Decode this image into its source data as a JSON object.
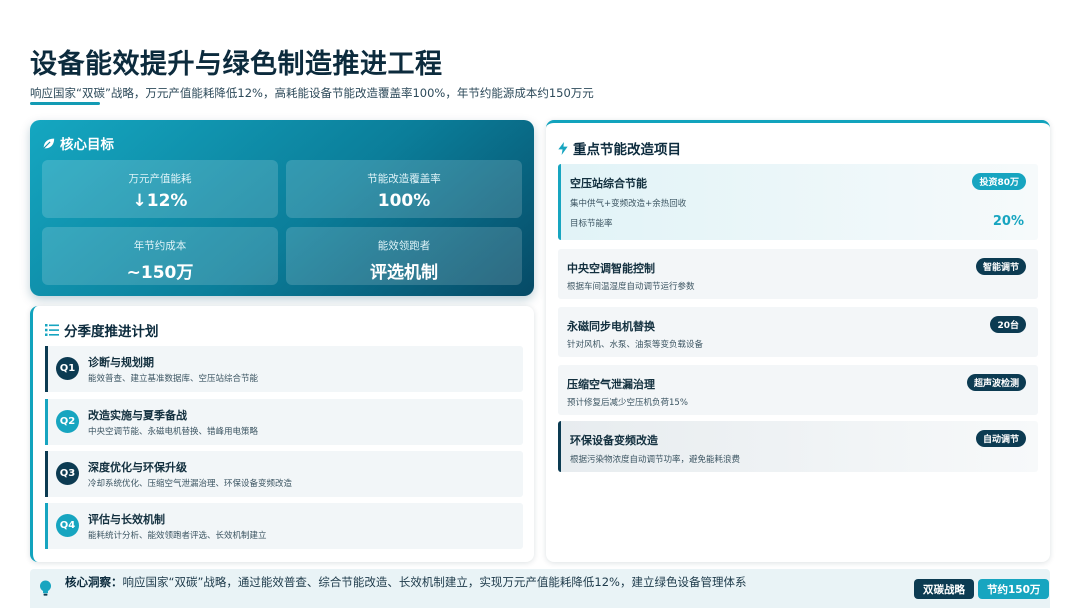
{
  "header": {
    "title": "设备能效提升与绿色制造推进工程",
    "subtitle": "响应国家“双碳”战略，万元产值能耗降低12%，高耗能设备节能改造覆盖率100%，年节约能源成本约150万元"
  },
  "core_targets": {
    "title": "核心目标",
    "icon": "leaf-icon",
    "metrics": [
      {
        "label": "万元产值能耗",
        "value": "↓12%"
      },
      {
        "label": "节能改造覆盖率",
        "value": "100%"
      },
      {
        "label": "年节约成本",
        "value": "~150万"
      },
      {
        "label": "能效领跑者",
        "value": "评选机制"
      }
    ]
  },
  "plan": {
    "title": "分季度推进计划",
    "icon": "list-icon",
    "items": [
      {
        "badge": "Q1",
        "title": "诊断与规划期",
        "desc": "能效普查、建立基准数据库、空压站综合节能"
      },
      {
        "badge": "Q2",
        "title": "改造实施与夏季备战",
        "desc": "中央空调节能、永磁电机替换、错峰用电策略"
      },
      {
        "badge": "Q3",
        "title": "深度优化与环保升级",
        "desc": "冷却系统优化、压缩空气泄漏治理、环保设备变频改造"
      },
      {
        "badge": "Q4",
        "title": "评估与长效机制",
        "desc": "能耗统计分析、能效领跑者评选、长效机制建立"
      }
    ]
  },
  "projects": {
    "title": "重点节能改造项目",
    "icon": "lightning-icon",
    "items": [
      {
        "title": "空压站综合节能",
        "tag": "投资80万",
        "desc": "集中供气+变频改造+余热回收",
        "rate_label": "目标节能率",
        "rate_value": "20%"
      },
      {
        "title": "中央空调智能控制",
        "tag": "智能调节",
        "desc": "根据车间温湿度自动调节运行参数"
      },
      {
        "title": "永磁同步电机替换",
        "tag": "20台",
        "desc": "针对风机、水泵、油泵等变负载设备"
      },
      {
        "title": "压缩空气泄漏治理",
        "tag": "超声波检测",
        "desc": "预计修复后减少空压机负荷15%"
      },
      {
        "title": "环保设备变频改造",
        "tag": "自动调节",
        "desc": "根据污染物浓度自动调节功率，避免能耗浪费"
      }
    ]
  },
  "insight": {
    "icon": "lightbulb-icon",
    "label": "核心洞察：",
    "text": "响应国家“双碳”战略，通过能效普查、综合节能改造、长效机制建立，实现万元产值能耗降低12%，建立绿色设备管理体系",
    "tags": [
      "双碳战略",
      "节约150万"
    ]
  },
  "colors": {
    "teal": "#17a5c0",
    "navy": "#0c3b52",
    "title": "#0c2b3d"
  }
}
